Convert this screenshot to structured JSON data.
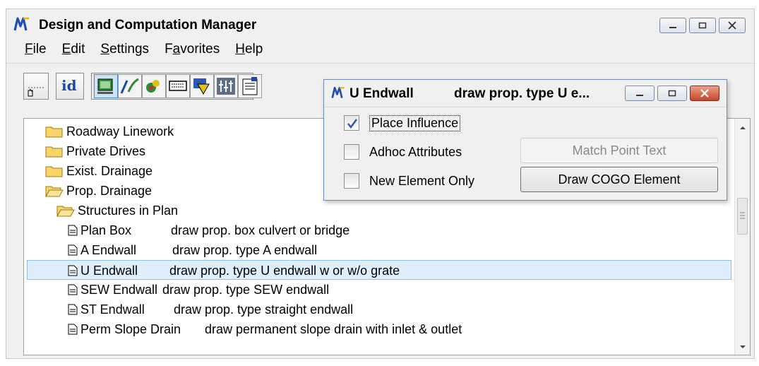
{
  "window": {
    "title": "Design and Computation Manager",
    "menu": [
      {
        "label": "File",
        "accel": "F",
        "rest": "ile"
      },
      {
        "label": "Edit",
        "accel": "E",
        "rest": "dit"
      },
      {
        "label": "Settings",
        "accel": "S",
        "rest": "ettings"
      },
      {
        "label": "Favorites",
        "accel": "a",
        "pre": "F",
        "rest": "vorites"
      },
      {
        "label": "Help",
        "accel": "H",
        "rest": "elp"
      }
    ]
  },
  "toolbar": {
    "buttons": [
      "place-cell-icon",
      "id-icon",
      "design-mode-icon",
      "pencil-icon",
      "element-attributes-icon",
      "keyin-icon",
      "shape-icon",
      "multi-icon",
      "properties-icon"
    ],
    "id_label": "id"
  },
  "tree": {
    "items": [
      {
        "type": "folder",
        "open": false,
        "label": "Roadway Linework",
        "desc": ""
      },
      {
        "type": "folder",
        "open": false,
        "label": "Private Drives",
        "desc": ""
      },
      {
        "type": "folder",
        "open": false,
        "label": "Exist. Drainage",
        "desc": ""
      },
      {
        "type": "folder",
        "open": true,
        "label": "Prop. Drainage",
        "desc": ""
      },
      {
        "type": "folder",
        "open": true,
        "label": "Structures in Plan",
        "desc": ""
      },
      {
        "type": "item",
        "label": "Plan Box",
        "desc": "draw prop. box culvert or bridge"
      },
      {
        "type": "item",
        "label": "A Endwall",
        "desc": "draw prop. type A endwall"
      },
      {
        "type": "item",
        "label": "U Endwall",
        "desc": "draw prop. type U endwall w or w/o grate",
        "selected": true
      },
      {
        "type": "item",
        "label": "SEW Endwall",
        "desc": "draw prop. type SEW endwall"
      },
      {
        "type": "item",
        "label": "ST Endwall",
        "desc": "draw prop. type straight endwall"
      },
      {
        "type": "item",
        "label": "Perm Slope Drain",
        "desc": "draw permanent slope drain with inlet & outlet"
      }
    ]
  },
  "dialog": {
    "title": "U Endwall",
    "title_desc": "draw prop. type U e...",
    "checkboxes": [
      {
        "label": "Place Influence",
        "checked": true
      },
      {
        "label": "Adhoc Attributes",
        "checked": false
      },
      {
        "label": "New Element Only",
        "checked": false
      }
    ],
    "match_point_text": "Match Point Text",
    "draw_cogo_element": "Draw COGO Element"
  },
  "colors": {
    "selection_bg": "#dfeefc",
    "selection_border": "#8fc0ea",
    "folder_yellow": "#f7d568",
    "title_icon_blue": "#1f4fb3"
  }
}
